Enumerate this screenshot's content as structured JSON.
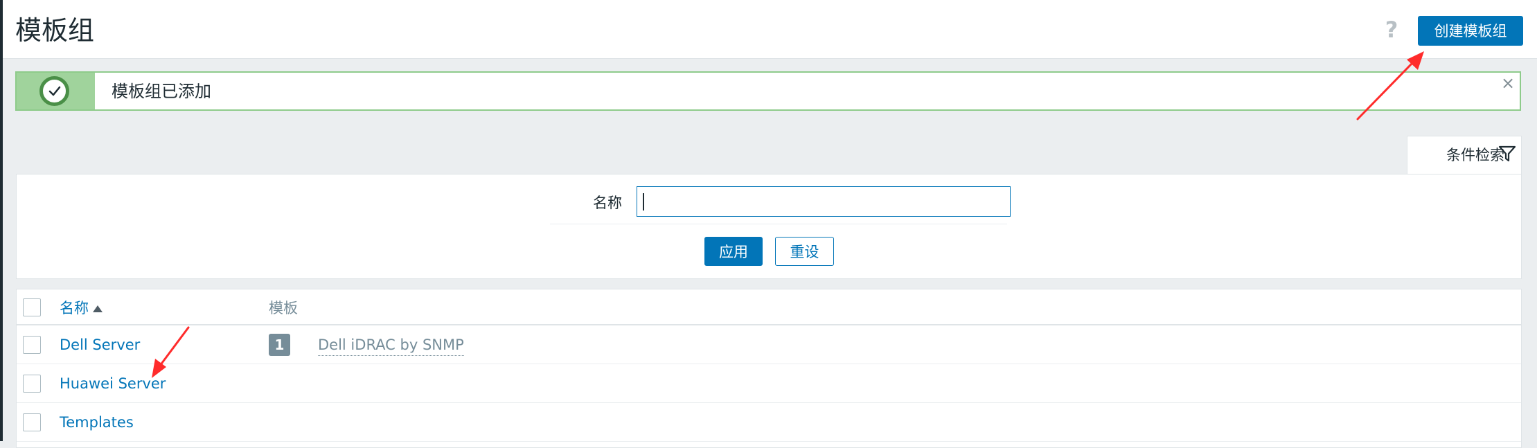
{
  "header": {
    "title": "模板组",
    "help_icon": "?",
    "create_button": "创建模板组"
  },
  "message": {
    "text": "模板组已添加",
    "icon": "check-icon",
    "close_symbol": "×",
    "status_color": "#4a8f47"
  },
  "filter": {
    "tab_label": "条件检索",
    "tab_icon": "filter-icon",
    "name_label": "名称",
    "name_value": "",
    "apply_button": "应用",
    "reset_button": "重设"
  },
  "table": {
    "columns": {
      "name": "名称",
      "templates": "模板"
    },
    "rows": [
      {
        "name": "Dell Server",
        "template_count": "1",
        "template_name": "Dell iDRAC by SNMP"
      },
      {
        "name": "Huawei Server"
      },
      {
        "name": "Templates"
      }
    ]
  },
  "colors": {
    "accent": "#0275b8",
    "annotation_arrow": "#ff2b2b"
  }
}
